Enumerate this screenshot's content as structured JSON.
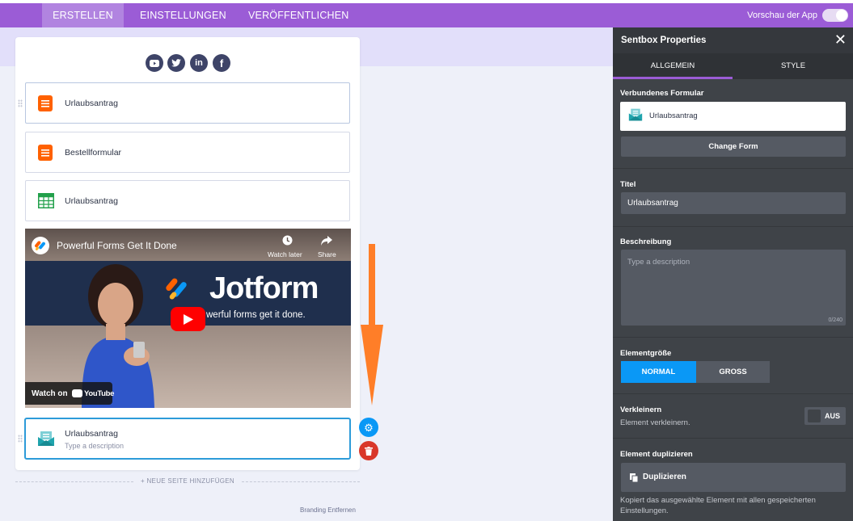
{
  "nav": {
    "tabs": [
      "ERSTELLEN",
      "EINSTELLUNGEN",
      "VERÖFFENTLICHEN"
    ],
    "preview_label": "Vorschau der App"
  },
  "app": {
    "items": [
      {
        "label": "Urlaubsantrag",
        "icon": "form-doc-icon"
      },
      {
        "label": "Bestellformular",
        "icon": "form-doc-icon"
      },
      {
        "label": "Urlaubsantrag",
        "icon": "sheet-grid-icon"
      }
    ],
    "video": {
      "title": "Powerful Forms Get It Done",
      "watch_later": "Watch later",
      "share": "Share",
      "brand": "Jotform",
      "tagline": "werful forms get it done.",
      "watch_on": "Watch on",
      "youtube": "YouTube"
    },
    "selected_item": {
      "title": "Urlaubsantrag",
      "description": "Type a description"
    },
    "new_page": "+ NEUE SEITE HINZUFÜGEN",
    "branding": "Branding Entfernen"
  },
  "panel": {
    "title": "Sentbox Properties",
    "tabs": [
      "ALLGEMEIN",
      "STYLE"
    ],
    "connected_form_label": "Verbundenes Formular",
    "connected_form_value": "Urlaubsantrag",
    "change_form": "Change Form",
    "title_label": "Titel",
    "title_value": "Urlaubsantrag",
    "description_label": "Beschreibung",
    "description_placeholder": "Type a description",
    "description_counter": "0/240",
    "size_label": "Elementgröße",
    "size_options": [
      "NORMAL",
      "GROSS"
    ],
    "shrink_label": "Verkleinern",
    "shrink_desc": "Element verkleinern.",
    "shrink_state": "AUS",
    "duplicate_label": "Element duplizieren",
    "duplicate_button": "Duplizieren",
    "duplicate_desc": "Kopiert das ausgewählte Element mit allen gespeicherten Einstellungen."
  },
  "colors": {
    "accent": "#9b5cd6",
    "blue": "#0a98f6",
    "orange": "#ff7e28",
    "red": "#d9372a"
  }
}
